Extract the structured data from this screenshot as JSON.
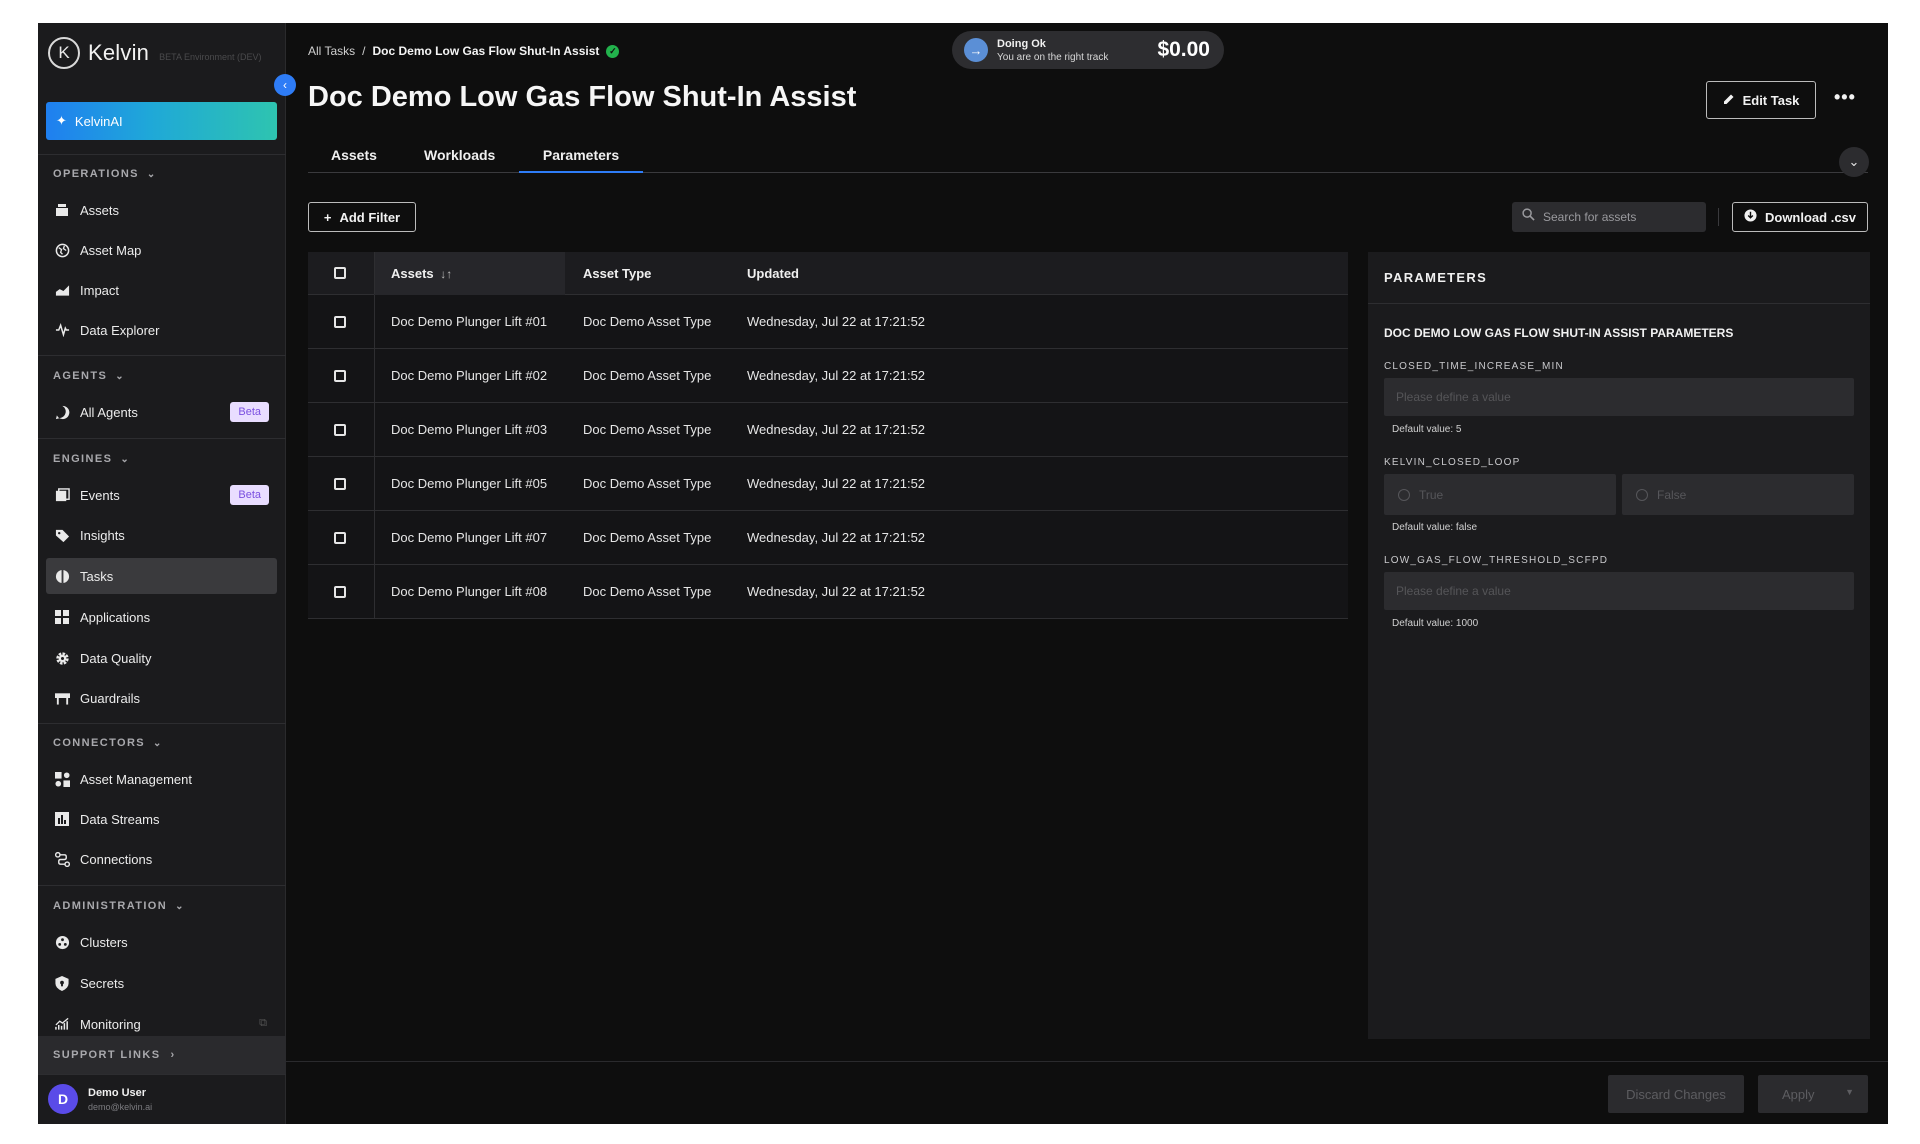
{
  "app": {
    "logo_symbol": "K",
    "logo_text": "Kelvin",
    "env_label": "BETA Environment (DEV)",
    "ai_button": "KelvinAI"
  },
  "sidebar": {
    "sections": [
      {
        "title": "OPERATIONS",
        "items": [
          {
            "label": "Assets",
            "icon": "assets-icon"
          },
          {
            "label": "Asset Map",
            "icon": "globe-icon"
          },
          {
            "label": "Impact",
            "icon": "impact-icon"
          },
          {
            "label": "Data Explorer",
            "icon": "waveform-icon"
          }
        ]
      },
      {
        "title": "AGENTS",
        "items": [
          {
            "label": "All Agents",
            "icon": "agent-icon",
            "badge": "Beta"
          }
        ]
      },
      {
        "title": "ENGINES",
        "items": [
          {
            "label": "Events",
            "icon": "events-icon",
            "badge": "Beta"
          },
          {
            "label": "Insights",
            "icon": "tag-icon"
          },
          {
            "label": "Tasks",
            "icon": "tasks-icon",
            "active": true
          },
          {
            "label": "Applications",
            "icon": "apps-icon"
          },
          {
            "label": "Data Quality",
            "icon": "gear-icon"
          },
          {
            "label": "Guardrails",
            "icon": "guardrails-icon"
          }
        ]
      },
      {
        "title": "CONNECTORS",
        "items": [
          {
            "label": "Asset Management",
            "icon": "asset-management-icon"
          },
          {
            "label": "Data Streams",
            "icon": "bar-chart-icon"
          },
          {
            "label": "Connections",
            "icon": "connections-icon"
          }
        ]
      },
      {
        "title": "ADMINISTRATION",
        "items": [
          {
            "label": "Clusters",
            "icon": "clusters-icon"
          },
          {
            "label": "Secrets",
            "icon": "shield-icon"
          },
          {
            "label": "Monitoring",
            "icon": "monitoring-icon"
          }
        ]
      }
    ],
    "support_links": "SUPPORT LINKS",
    "user": {
      "initial": "D",
      "name": "Demo User",
      "email": "demo@kelvin.ai"
    }
  },
  "header": {
    "breadcrumb_root": "All Tasks",
    "breadcrumb_sep": "/",
    "breadcrumb_current": "Doc Demo Low Gas Flow Shut-In Assist",
    "status_title": "Doing Ok",
    "status_sub": "You are on the right track",
    "status_amount": "$0.00",
    "title": "Doc Demo Low Gas Flow Shut-In Assist",
    "edit_label": "Edit Task",
    "more_label": "•••"
  },
  "tabs": [
    {
      "label": "Assets"
    },
    {
      "label": "Workloads"
    },
    {
      "label": "Parameters",
      "active": true
    }
  ],
  "toolbar": {
    "add_filter": "Add Filter",
    "search_placeholder": "Search for assets",
    "download": "Download .csv"
  },
  "table": {
    "columns": [
      "Assets",
      "Asset Type",
      "Updated"
    ],
    "sort_glyph": "↓↑",
    "rows": [
      {
        "asset": "Doc Demo Plunger Lift #01",
        "type": "Doc Demo Asset Type",
        "updated": "Wednesday, Jul 22 at 17:21:52"
      },
      {
        "asset": "Doc Demo Plunger Lift #02",
        "type": "Doc Demo Asset Type",
        "updated": "Wednesday, Jul 22 at 17:21:52"
      },
      {
        "asset": "Doc Demo Plunger Lift #03",
        "type": "Doc Demo Asset Type",
        "updated": "Wednesday, Jul 22 at 17:21:52"
      },
      {
        "asset": "Doc Demo Plunger Lift #05",
        "type": "Doc Demo Asset Type",
        "updated": "Wednesday, Jul 22 at 17:21:52"
      },
      {
        "asset": "Doc Demo Plunger Lift #07",
        "type": "Doc Demo Asset Type",
        "updated": "Wednesday, Jul 22 at 17:21:52"
      },
      {
        "asset": "Doc Demo Plunger Lift #08",
        "type": "Doc Demo Asset Type",
        "updated": "Wednesday, Jul 22 at 17:21:52"
      }
    ]
  },
  "parameters": {
    "header": "PARAMETERS",
    "title": "DOC DEMO LOW GAS FLOW SHUT-IN ASSIST PARAMETERS",
    "fields": [
      {
        "name": "CLOSED_TIME_INCREASE_MIN",
        "placeholder": "Please define a value",
        "default": "Default value: 5"
      },
      {
        "name": "KELVIN_CLOSED_LOOP",
        "options": [
          "True",
          "False"
        ],
        "default": "Default value: false"
      },
      {
        "name": "LOW_GAS_FLOW_THRESHOLD_SCFPD",
        "placeholder": "Please define a value",
        "default": "Default value: 1000"
      }
    ]
  },
  "footer": {
    "discard": "Discard Changes",
    "apply": "Apply"
  },
  "colors": {
    "accent": "#2e7cf6",
    "beta_badge_bg": "#e9ddff",
    "beta_badge_text": "#7a4fe0",
    "success": "#22b24c"
  }
}
